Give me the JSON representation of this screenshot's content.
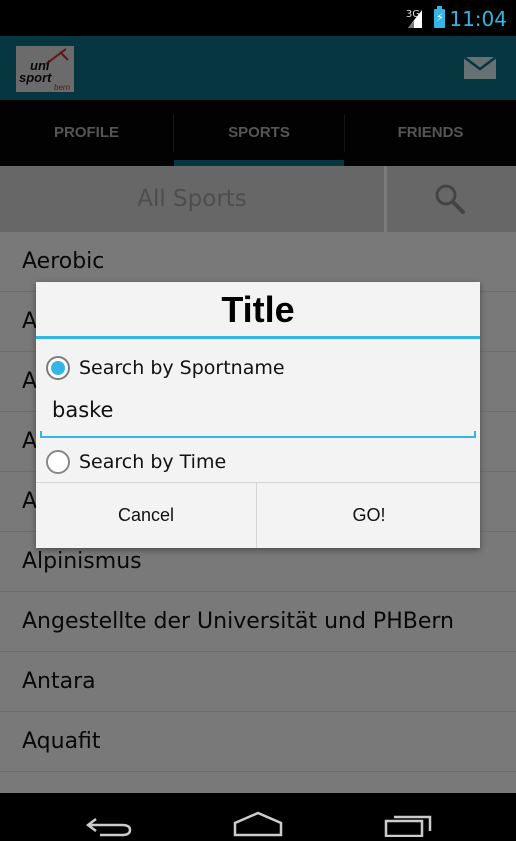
{
  "status_bar": {
    "network": "3G",
    "time": "11:04",
    "battery_icon": "battery-charging-icon",
    "signal_icon": "signal-icon",
    "accent": "#33b5e5"
  },
  "action_bar": {
    "logo_line1": "uni",
    "logo_line2": "sport",
    "logo_line3": "bern",
    "mail_icon": "mail-icon",
    "background": "#0c6f80"
  },
  "tabs": [
    {
      "label": "PROFILE",
      "selected": false
    },
    {
      "label": "SPORTS",
      "selected": true
    },
    {
      "label": "FRIENDS",
      "selected": false
    }
  ],
  "search": {
    "label": "All Sports",
    "icon": "search-icon"
  },
  "sports": [
    "Aerobic",
    "A",
    "A",
    "A",
    "A",
    "Alpinismus",
    "Angestellte der Universität und PHBern",
    "Antara",
    "Aquafit"
  ],
  "dialog": {
    "title": "Title",
    "option_name": "Search by Sportname",
    "option_name_selected": true,
    "input_value": "baske",
    "option_time": "Search by Time",
    "option_time_selected": false,
    "cancel": "Cancel",
    "go": "GO!"
  },
  "nav_bar": {
    "back_icon": "back-icon",
    "home_icon": "home-icon",
    "recents_icon": "recents-icon"
  }
}
